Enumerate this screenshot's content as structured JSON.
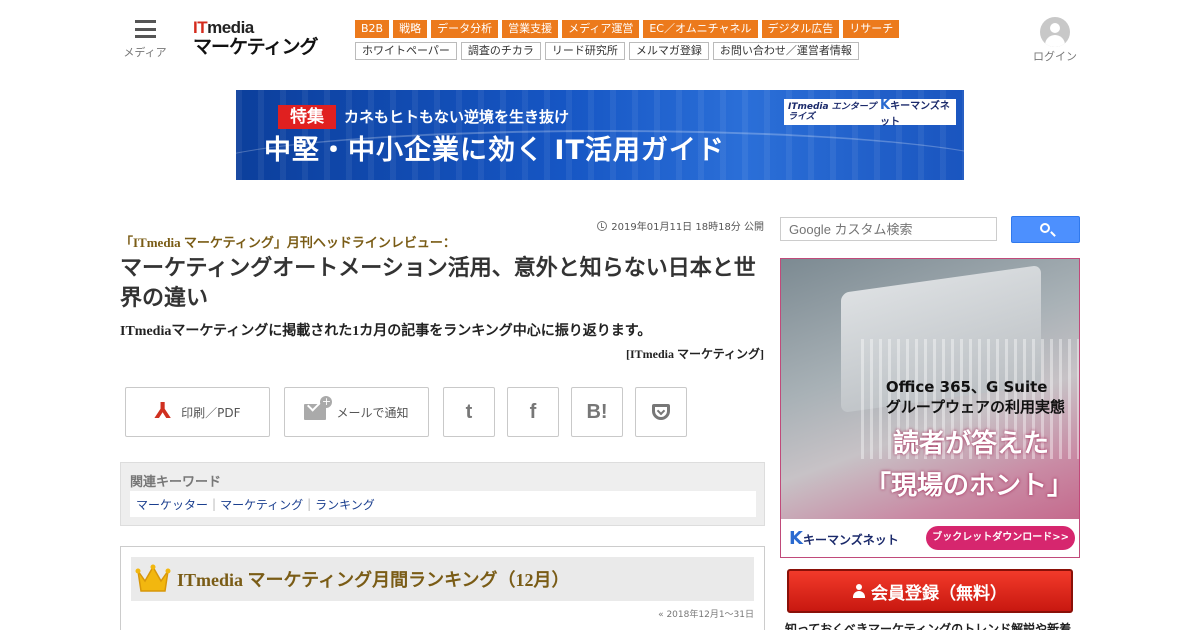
{
  "header": {
    "menu_label": "メディア",
    "logo_it": "IT",
    "logo_media": "media",
    "logo_name": "マーケティング",
    "categories": [
      "B2B",
      "戦略",
      "データ分析",
      "営業支援",
      "メディア運営",
      "EC／オムニチャネル",
      "デジタル広告",
      "リサーチ"
    ],
    "sub_links": [
      "ホワイトペーパー",
      "調査のチカラ",
      "リード研究所",
      "メルマガ登録",
      "お問い合わせ／運営者情報"
    ],
    "login_label": "ログイン"
  },
  "banner": {
    "tag": "特集",
    "subtitle": "カネもヒトもない逆境を生き抜け",
    "title": "中堅・中小企業に効く IT活用ガイド",
    "sponsor_1": "ITmedia エンタープライズ",
    "sponsor_2": "キーマンズネット",
    "sponsor_2_k": "K"
  },
  "article": {
    "date": "2019年01月11日 18時18分 公開",
    "kicker": "「ITmedia マーケティング」月刊ヘッドラインレビュー：",
    "title": "マーケティングオートメーション活用、意外と知らない日本と世界の違い",
    "lead": "ITmediaマーケティングに掲載された1カ月の記事をランキング中心に振り返ります。",
    "byline": "[ITmedia マーケティング]",
    "share": {
      "print_label": "印刷／PDF",
      "mail_label": "メールで通知",
      "twitter_glyph": "t",
      "facebook_glyph": "f",
      "hatena_glyph": "B!"
    },
    "keywords": {
      "heading": "関連キーワード",
      "items": [
        "マーケッター",
        "マーケティング",
        "ランキング"
      ]
    },
    "ranking": {
      "title": "ITmedia マーケティング月間ランキング（12月）",
      "period": "« 2018年12月1～31日"
    }
  },
  "sidebar": {
    "search_placeholder": "Google カスタム検索",
    "ad": {
      "line1": "Office 365、G Suite",
      "line2": "グループウェアの利用実態",
      "headline1": "読者が答えた",
      "headline2": "「現場のホント」",
      "brand": "キーマンズネット",
      "brand_k": "K",
      "cta": "ブックレットダウンロード>>"
    },
    "register_label": "会員登録（無料）",
    "teaser": "知っておくべきマーケティングのトレンド解説や新着"
  },
  "colors": {
    "category_orange": "#ec7a1c",
    "logo_red": "#d42b1d",
    "kicker_brown": "#7a5c16",
    "search_blue": "#4d90fe",
    "register_red": "#d8201a"
  }
}
